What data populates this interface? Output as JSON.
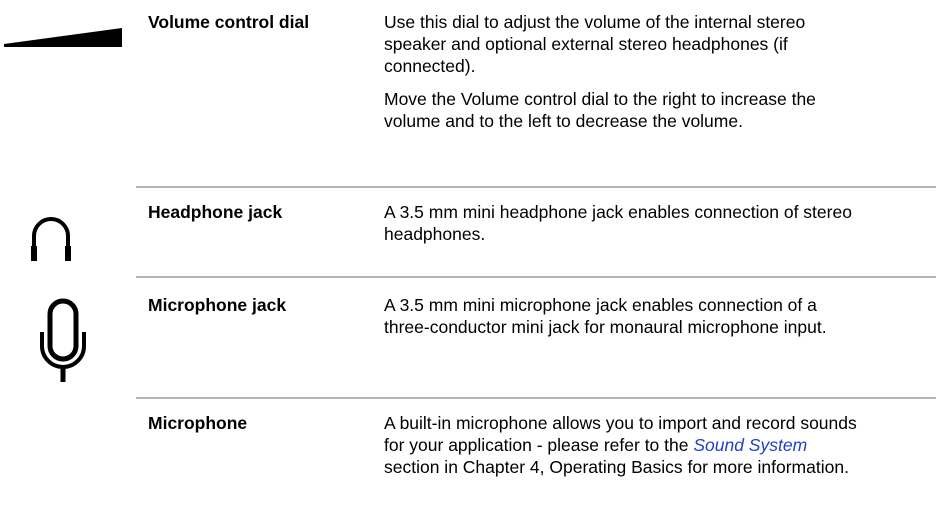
{
  "entries": [
    {
      "term": "Volume control dial",
      "icon": "volume-wedge-icon",
      "paragraphs": [
        "Use this dial to adjust the volume of the internal stereo speaker and optional external stereo headphones (if connected).",
        "Move the Volume control dial to the right to increase the volume and to the left to decrease the volume."
      ]
    },
    {
      "term": "Headphone jack",
      "icon": "headphone-icon",
      "paragraphs": [
        "A 3.5 mm mini headphone jack enables connection of stereo headphones."
      ]
    },
    {
      "term": "Microphone jack",
      "icon": "microphone-icon",
      "paragraphs": [
        "A 3.5 mm mini microphone jack enables connection of a three-conductor mini jack for monaural microphone input."
      ]
    },
    {
      "term": "Microphone",
      "paragraphs_parts": {
        "before": "A built-in microphone allows you to import and record sounds for your application - please refer to the ",
        "link": "Sound System",
        "after": " section in Chapter 4, Operating Basics for more information."
      }
    }
  ],
  "colors": {
    "link": "#1f3fd1",
    "divider": "#b5b5b5"
  }
}
